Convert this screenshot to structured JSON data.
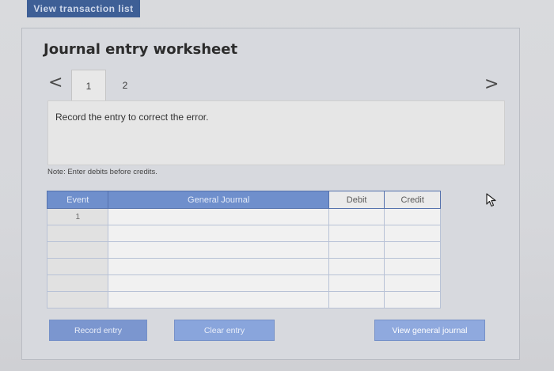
{
  "top_tab": {
    "label": "View transaction list"
  },
  "worksheet": {
    "title": "Journal entry worksheet",
    "tabs": [
      {
        "label": "1"
      },
      {
        "label": "2"
      }
    ],
    "instruction": "Record the entry to correct the error.",
    "note": "Note: Enter debits before credits."
  },
  "table": {
    "headers": {
      "event": "Event",
      "general_journal": "General Journal",
      "debit": "Debit",
      "credit": "Credit"
    },
    "rows": [
      {
        "event": "1"
      },
      {
        "event": ""
      },
      {
        "event": ""
      },
      {
        "event": ""
      },
      {
        "event": ""
      },
      {
        "event": ""
      }
    ]
  },
  "buttons": {
    "record": "Record entry",
    "clear": "Clear entry",
    "view_journal": "View general journal"
  },
  "icons": {
    "prev": "chevron-left-icon",
    "next": "chevron-right-icon",
    "cursor": "mouse-pointer-icon"
  },
  "colors": {
    "header_blue": "#6f8fcc",
    "button_blue": "#7b96cf",
    "top_tab": "#3e5f96"
  }
}
